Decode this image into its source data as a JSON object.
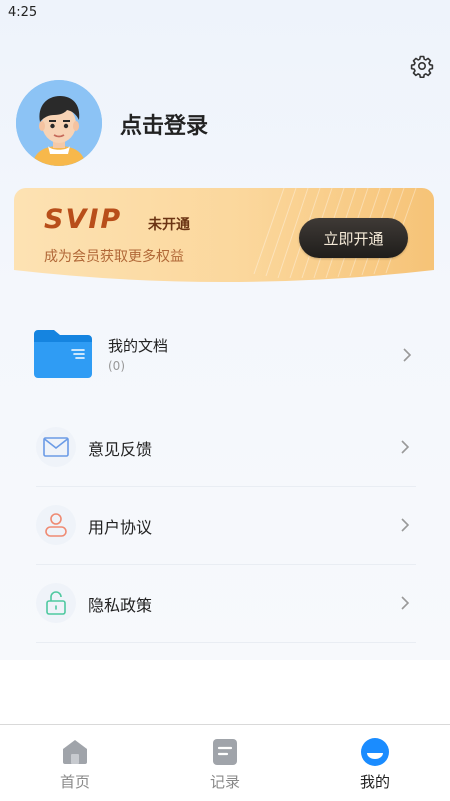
{
  "status_bar": {
    "time": "4:25"
  },
  "header": {
    "login_text": "点击登录"
  },
  "vip": {
    "logo": "SVIP",
    "status": "未开通",
    "description": "成为会员获取更多权益",
    "button_label": "立即开通"
  },
  "documents": {
    "title": "我的文档",
    "count": "(0)"
  },
  "menu": [
    {
      "label": "意见反馈",
      "icon": "mail-icon"
    },
    {
      "label": "用户协议",
      "icon": "user-icon"
    },
    {
      "label": "隐私政策",
      "icon": "unlock-icon"
    }
  ],
  "tabs": [
    {
      "label": "首页",
      "icon": "home-icon",
      "active": false
    },
    {
      "label": "记录",
      "icon": "record-icon",
      "active": false
    },
    {
      "label": "我的",
      "icon": "profile-icon",
      "active": true
    }
  ],
  "colors": {
    "accent": "#1a8cff",
    "vip_gold": "#f6c77a",
    "vip_text": "#b84e1a"
  }
}
